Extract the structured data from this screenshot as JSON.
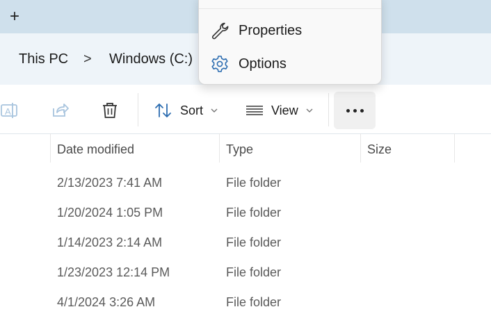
{
  "tabbar": {
    "new_tab_glyph": "+"
  },
  "breadcrumb": {
    "items": [
      "This PC",
      "Windows (C:)"
    ],
    "separator": ">"
  },
  "toolbar": {
    "rename_icon": "rename-icon",
    "share_icon": "share-icon",
    "delete_icon": "trash-icon",
    "sort_label": "Sort",
    "view_label": "View",
    "more_icon": "more-icon"
  },
  "columns": [
    "Date modified",
    "Type",
    "Size"
  ],
  "rows": [
    {
      "date": "2/13/2023 7:41 AM",
      "type": "File folder"
    },
    {
      "date": "1/20/2024 1:05 PM",
      "type": "File folder"
    },
    {
      "date": "1/14/2023 2:14 AM",
      "type": "File folder"
    },
    {
      "date": "1/23/2023 12:14 PM",
      "type": "File folder"
    },
    {
      "date": "4/1/2024 3:26 AM",
      "type": "File folder"
    }
  ],
  "menu": {
    "items": [
      {
        "label": "Properties",
        "icon": "wrench-icon"
      },
      {
        "label": "Options",
        "icon": "gear-icon"
      }
    ]
  },
  "colors": {
    "accent": "#2b6cb0",
    "tabbar": "#cfe0ec",
    "addressbar": "#eef4f9"
  }
}
